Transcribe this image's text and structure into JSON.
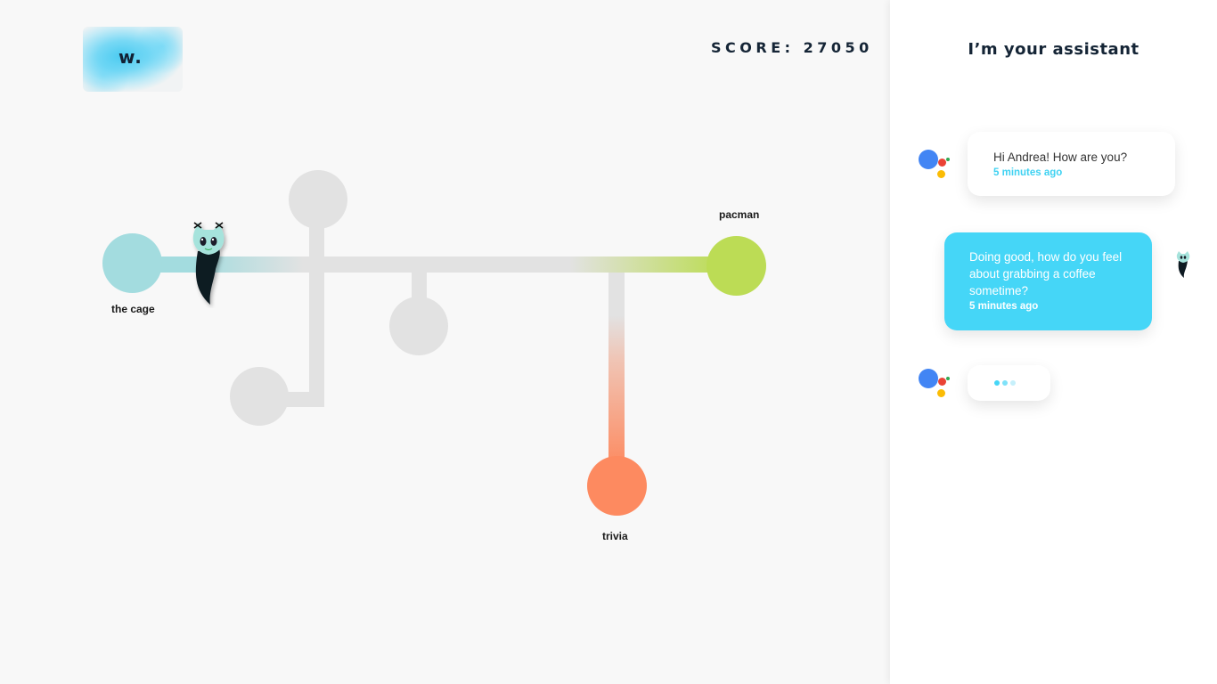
{
  "header": {
    "logo_text": "w.",
    "score_label": "SCORE: 27050"
  },
  "map": {
    "nodes": {
      "cage": {
        "label": "the cage",
        "color": "#a3dcdf"
      },
      "pacman": {
        "label": "pacman",
        "color": "#bcdc55"
      },
      "trivia": {
        "label": "trivia",
        "color": "#fd8a60"
      }
    },
    "track_color": "#e2e2e2",
    "player_icon": "cat-ghost-icon"
  },
  "assistant": {
    "title": "I’m your assistant",
    "messages": [
      {
        "from": "assistant",
        "text": "Hi Andrea! How are you?",
        "time": "5 minutes ago"
      },
      {
        "from": "user",
        "text": "Doing good, how do you feel about grabbing a coffee sometime?",
        "time": "5 minutes ago"
      },
      {
        "from": "assistant",
        "typing": true
      }
    ],
    "colors": {
      "accent": "#45d6f7",
      "ga_blue": "#4285f4",
      "ga_red": "#ea4335",
      "ga_yellow": "#fbbc05",
      "ga_green": "#34a853"
    }
  }
}
